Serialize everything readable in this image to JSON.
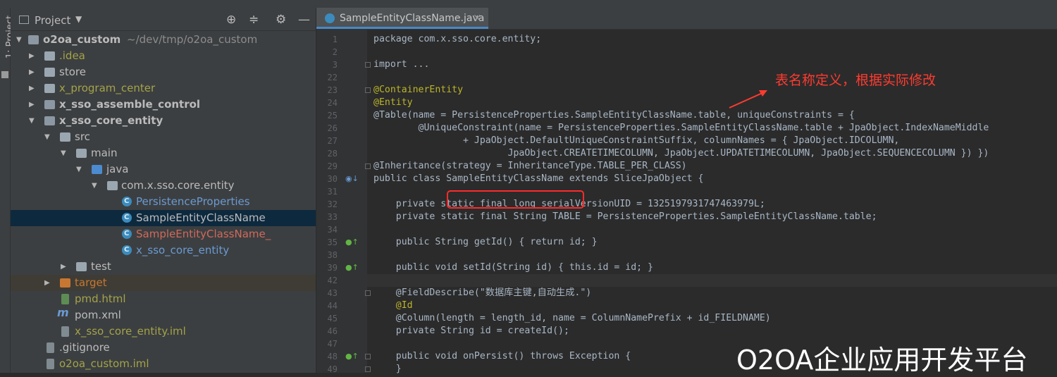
{
  "sidebar_label": "1: Project",
  "project_panel": {
    "title": "Project",
    "tree": [
      {
        "label": "o2oa_custom",
        "suffix": "~/dev/tmp/o2oa_custom"
      },
      {
        "label": ".idea"
      },
      {
        "label": "store"
      },
      {
        "label": "x_program_center"
      },
      {
        "label": "x_sso_assemble_control"
      },
      {
        "label": "x_sso_core_entity"
      },
      {
        "label": "src"
      },
      {
        "label": "main"
      },
      {
        "label": "java"
      },
      {
        "label": "com.x.sso.core.entity"
      },
      {
        "label": "PersistenceProperties"
      },
      {
        "label": "SampleEntityClassName"
      },
      {
        "label": "SampleEntityClassName_"
      },
      {
        "label": "x_sso_core_entity"
      },
      {
        "label": "test"
      },
      {
        "label": "target"
      },
      {
        "label": "pmd.html"
      },
      {
        "label": "pom.xml"
      },
      {
        "label": "x_sso_core_entity.iml"
      },
      {
        "label": ".gitignore"
      },
      {
        "label": "o2oa_custom.iml"
      }
    ]
  },
  "editor": {
    "tab_label": "SampleEntityClassName.java",
    "line_numbers": [
      "1",
      "2",
      "3",
      "22",
      "23",
      "24",
      "25",
      "26",
      "27",
      "28",
      "29",
      "30",
      "31",
      "32",
      "33",
      "34",
      "35",
      "38",
      "39",
      "42",
      "43",
      "44",
      "45",
      "46",
      "47",
      "48",
      "49"
    ],
    "code_lines": [
      "package com.x.sso.core.entity;",
      "",
      "import ...",
      "",
      "@ContainerEntity",
      "@Entity",
      "@Table(name = PersistenceProperties.SampleEntityClassName.table, uniqueConstraints = {",
      "        @UniqueConstraint(name = PersistenceProperties.SampleEntityClassName.table + JpaObject.IndexNameMiddle",
      "                + JpaObject.DefaultUniqueConstraintSuffix, columnNames = { JpaObject.IDCOLUMN,",
      "                        JpaObject.CREATETIMECOLUMN, JpaObject.UPDATETIMECOLUMN, JpaObject.SEQUENCECOLUMN }) })",
      "@Inheritance(strategy = InheritanceType.TABLE_PER_CLASS)",
      "public class SampleEntityClassName extends SliceJpaObject {",
      "",
      "    private static final long serialVersionUID = 1325197931747463979L;",
      "    private static final String TABLE = PersistenceProperties.SampleEntityClassName.table;",
      "",
      "    public String getId() { return id; }",
      "",
      "    public void setId(String id) { this.id = id; }",
      "",
      "    @FieldDescribe(\"数据库主键,自动生成.\")",
      "    @Id",
      "    @Column(length = length_id, name = ColumnNamePrefix + id_FIELDNAME)",
      "    private String id = createId();",
      "",
      "    public void onPersist() throws Exception {",
      "    }"
    ]
  },
  "annotation_text": "表名称定义，根据实际修改",
  "watermark": "O2OA企业应用开发平台"
}
